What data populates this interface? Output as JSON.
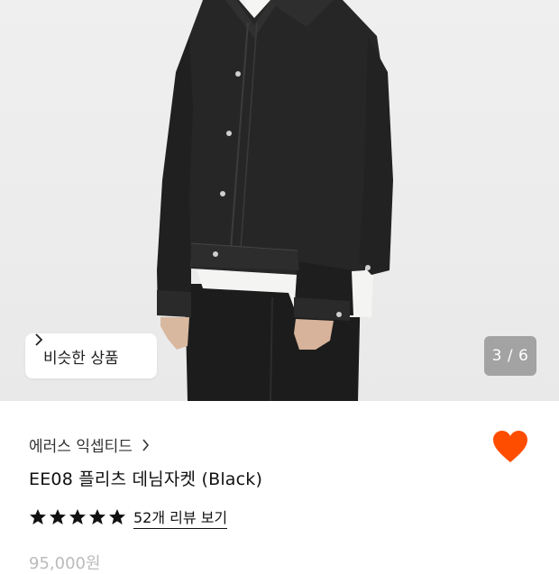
{
  "gallery": {
    "similar_button_label": "비슷한 상품",
    "page_counter": "3 / 6"
  },
  "product": {
    "brand": "에러스 익셉티드",
    "title": "EE08 플리츠 데님자켓 (Black)",
    "rating_stars": 5,
    "review_link": "52개 리뷰 보기",
    "price_partial": "95,000원",
    "wishlisted": true
  },
  "colors": {
    "accent": "#FF4D00",
    "star": "#111111"
  }
}
